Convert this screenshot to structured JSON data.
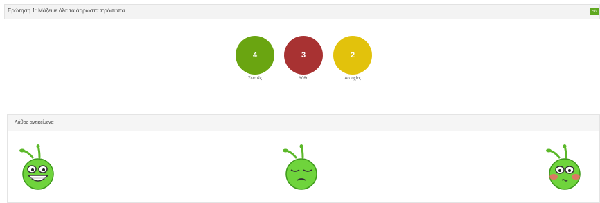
{
  "question": {
    "title": "Ερώτηση 1: Μάζεψε όλα τα άρρωστα πρόσωπα.",
    "action_label": "Θέλ"
  },
  "stats": [
    {
      "value": "4",
      "label": "Σωστές",
      "color": "#6aa511"
    },
    {
      "value": "3",
      "label": "Λάθη",
      "color": "#a83232"
    },
    {
      "value": "2",
      "label": "Αστοχίες",
      "color": "#e2c20c"
    }
  ],
  "wrong_items": {
    "header": "Λάθος αντικείμενα",
    "items": [
      {
        "icon": "grinning-alien-face-icon"
      },
      {
        "icon": "sleepy-alien-face-icon"
      },
      {
        "icon": "blushing-alien-face-icon"
      }
    ]
  }
}
